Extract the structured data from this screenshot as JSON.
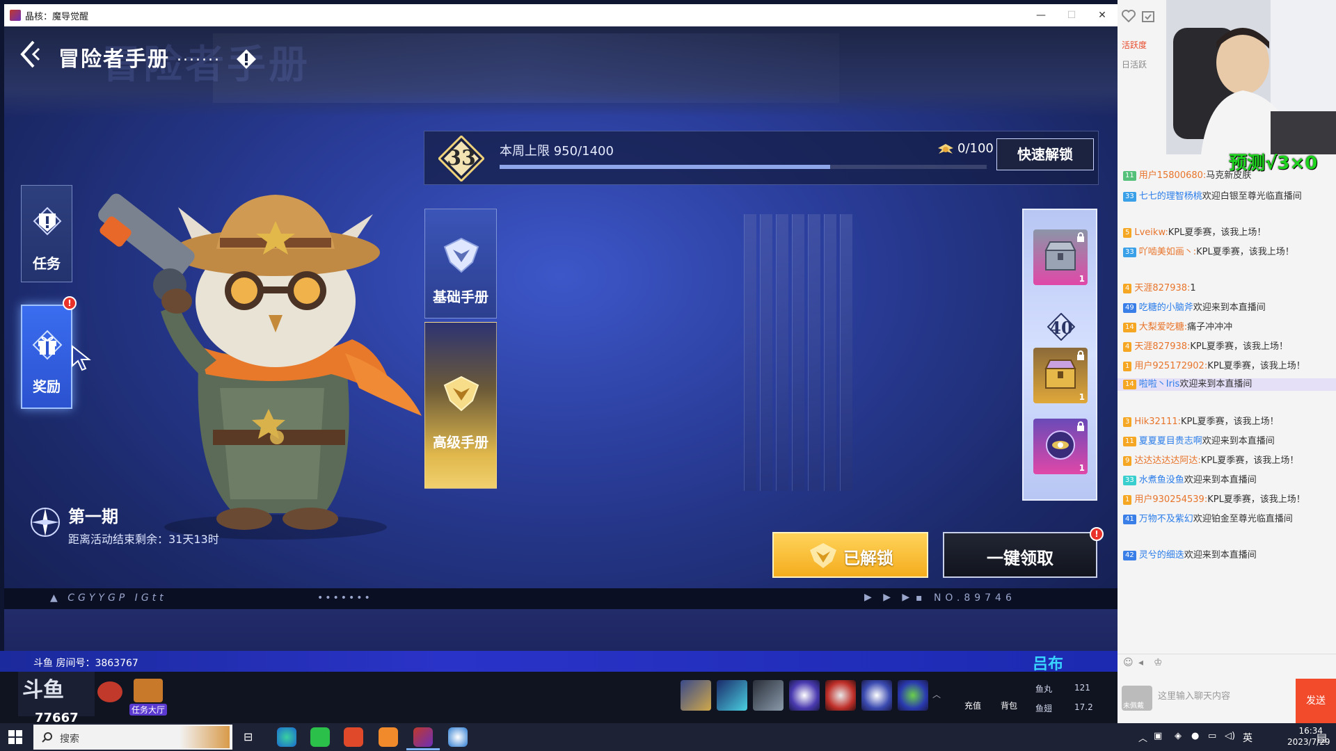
{
  "window": {
    "title": "晶核：魔导觉醒",
    "minimize": "—",
    "maximize": "☐",
    "close": "✕"
  },
  "header": {
    "title": "冒险者手册",
    "dots": ".......",
    "watermark": "冒险者手册"
  },
  "left_nav": {
    "tasks": "任务",
    "rewards": "奖励"
  },
  "period": {
    "title": "第一期",
    "countdown": "距离活动结束剩余：31天13时"
  },
  "level": {
    "value": "33",
    "week_limit": "本周上限 950/1400",
    "week_progress": 0.679,
    "exp_count": "0/100",
    "quick_unlock": "快速解锁"
  },
  "manual_tabs": {
    "basic": "基础手册",
    "advanced": "高级手册"
  },
  "rewards": {
    "level": "40",
    "items": [
      {
        "name": "steel-chest",
        "count": "1"
      },
      {
        "name": "gold-chest",
        "count": "1"
      },
      {
        "name": "orb",
        "count": "1"
      }
    ]
  },
  "buttons": {
    "unlocked": "已解锁",
    "claim_all": "一键领取",
    "claim_all_alert": "!"
  },
  "strip": {
    "left": "▲ CGYYGP IGtt",
    "left_dots": "•••••••",
    "arrows": "▶ ▶ ▶",
    "right": "▪ NO.89746"
  },
  "stream": {
    "room": "斗鱼 房间号：3863767",
    "streamer": "吕布",
    "viewers": "77667",
    "task_hall": "任务大厅",
    "recharge": "充值",
    "backpack": "背包",
    "fish_ball_label": "鱼丸",
    "fish_ball_value": "121",
    "fish_wing_label": "鱼翅",
    "fish_wing_value": "17.2",
    "prediction": "预测√3×0",
    "chat_placeholder": "这里输入聊天内容",
    "send": "发送",
    "not_logged": "未佩戴",
    "top_label": "活跃度",
    "top_sub": "日活跃"
  },
  "chat": [
    {
      "badge": "11",
      "badge_color": "#54c07a",
      "user": "用户15800680:",
      "text": "马克新皮肤"
    },
    {
      "badge": "33",
      "badge_color": "#3aa0e8",
      "user": "七七的理智杨桃",
      "text": "欢迎白银至尊光临直播间"
    },
    {
      "badge": "5",
      "badge_color": "#f5a623",
      "user": "Lveikw:",
      "text": "KPL夏季赛，该我上场！"
    },
    {
      "badge": "33",
      "badge_color": "#3aa0e8",
      "user": "吖啮美如画丶:",
      "text": "KPL夏季赛，该我上场！"
    },
    {
      "badge": "4",
      "badge_color": "#f5a623",
      "user": "天涯827938:",
      "text": "1"
    },
    {
      "badge": "49",
      "badge_color": "#3a7ee8",
      "user": "吃糖的小脑斧",
      "text": "欢迎来到本直播间"
    },
    {
      "badge": "14",
      "badge_color": "#f5a623",
      "user": "大梨爱吃糖:",
      "text": "痛子冲冲冲"
    },
    {
      "badge": "4",
      "badge_color": "#f5a623",
      "user": "天涯827938:",
      "text": "KPL夏季赛，该我上场！"
    },
    {
      "badge": "1",
      "badge_color": "#f5a623",
      "user": "用户925172902:",
      "text": "KPL夏季赛，该我上场！"
    },
    {
      "badge": "14",
      "badge_color": "#f5a623",
      "user": "啦啦丶Iris",
      "text": "欢迎来到本直播间"
    },
    {
      "badge": "3",
      "badge_color": "#f5a623",
      "user": "Hik32111:",
      "text": "KPL夏季赛，该我上场！"
    },
    {
      "badge": "11",
      "badge_color": "#f5a623",
      "user": "夏夏夏目贵志啊",
      "text": "欢迎来到本直播间"
    },
    {
      "badge": "9",
      "badge_color": "#f5a623",
      "user": "达达达达达阿达:",
      "text": "KPL夏季赛，该我上场！"
    },
    {
      "badge": "33",
      "badge_color": "#3acfcf",
      "user": "水煮鱼没鱼",
      "text": "欢迎来到本直播间"
    },
    {
      "badge": "1",
      "badge_color": "#f5a623",
      "user": "用户930254539:",
      "text": "KPL夏季赛，该我上场！"
    },
    {
      "badge": "41",
      "badge_color": "#3a7ee8",
      "user": "万物不及紫幻",
      "text": "欢迎铂金至尊光临直播间"
    },
    {
      "badge": "42",
      "badge_color": "#3a7ee8",
      "user": "灵兮的细迭",
      "text": "欢迎来到本直播间"
    }
  ],
  "taskbar": {
    "search": "搜索",
    "ime": "英",
    "time": "16:34",
    "date": "2023/7/29"
  },
  "colors": {
    "accent": "#3a6df0",
    "gold": "#f4ad1e",
    "alert": "#e8322a"
  }
}
